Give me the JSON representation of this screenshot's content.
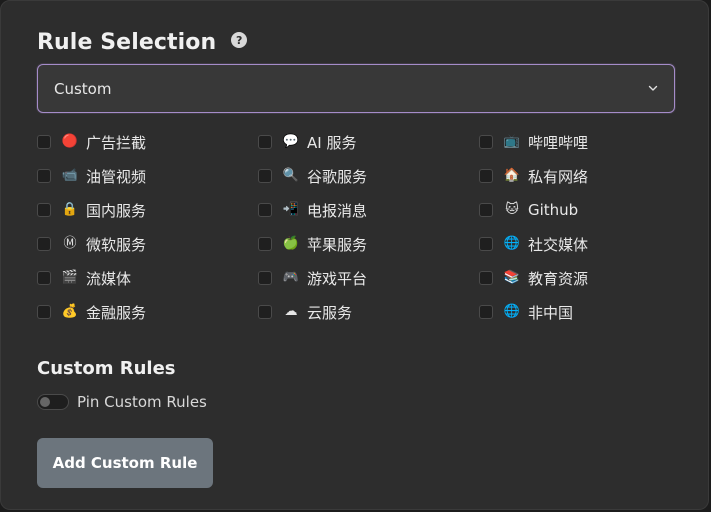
{
  "header": {
    "title": "Rule Selection",
    "help_icon": "question-circle-icon",
    "help_glyph": "?"
  },
  "select": {
    "value": "Custom",
    "icon": "chevron-down-icon"
  },
  "rules": [
    {
      "label": "广告拦截",
      "icon": "red-circle-icon",
      "glyph": "🔴",
      "checked": false
    },
    {
      "label": "AI 服务",
      "icon": "speech-bubble-icon",
      "glyph": "💬",
      "checked": false
    },
    {
      "label": "哔哩哔哩",
      "icon": "tv-icon",
      "glyph": "📺",
      "checked": false
    },
    {
      "label": "油管视频",
      "icon": "video-camera-icon",
      "glyph": "📹",
      "checked": false
    },
    {
      "label": "谷歌服务",
      "icon": "magnifier-icon",
      "glyph": "🔍",
      "checked": false
    },
    {
      "label": "私有网络",
      "icon": "house-icon",
      "glyph": "🏠",
      "checked": false
    },
    {
      "label": "国内服务",
      "icon": "lock-icon",
      "glyph": "🔒",
      "checked": false
    },
    {
      "label": "电报消息",
      "icon": "telegram-icon",
      "glyph": "📲",
      "checked": false
    },
    {
      "label": "Github",
      "icon": "cat-icon",
      "glyph": "🐱",
      "checked": false
    },
    {
      "label": "微软服务",
      "icon": "m-badge-icon",
      "glyph": "Ⓜ",
      "checked": false
    },
    {
      "label": "苹果服务",
      "icon": "apple-icon",
      "glyph": "🍏",
      "checked": false
    },
    {
      "label": "社交媒体",
      "icon": "globe-icon",
      "glyph": "🌐",
      "checked": false
    },
    {
      "label": "流媒体",
      "icon": "clapper-icon",
      "glyph": "🎬",
      "checked": false
    },
    {
      "label": "游戏平台",
      "icon": "gamepad-icon",
      "glyph": "🎮",
      "checked": false
    },
    {
      "label": "教育资源",
      "icon": "books-icon",
      "glyph": "📚",
      "checked": false
    },
    {
      "label": "金融服务",
      "icon": "money-bag-icon",
      "glyph": "💰",
      "checked": false
    },
    {
      "label": "云服务",
      "icon": "cloud-icon",
      "glyph": "☁",
      "checked": false
    },
    {
      "label": "非中国",
      "icon": "globe-icon",
      "glyph": "🌐",
      "checked": false
    }
  ],
  "custom_rules": {
    "title": "Custom Rules",
    "pin_label": "Pin Custom Rules",
    "pin_enabled": false,
    "add_button_label": "Add Custom Rule"
  },
  "colors": {
    "panel_bg": "#2d2d2d",
    "select_border": "#a58cc9",
    "button_bg": "#6c757d"
  }
}
